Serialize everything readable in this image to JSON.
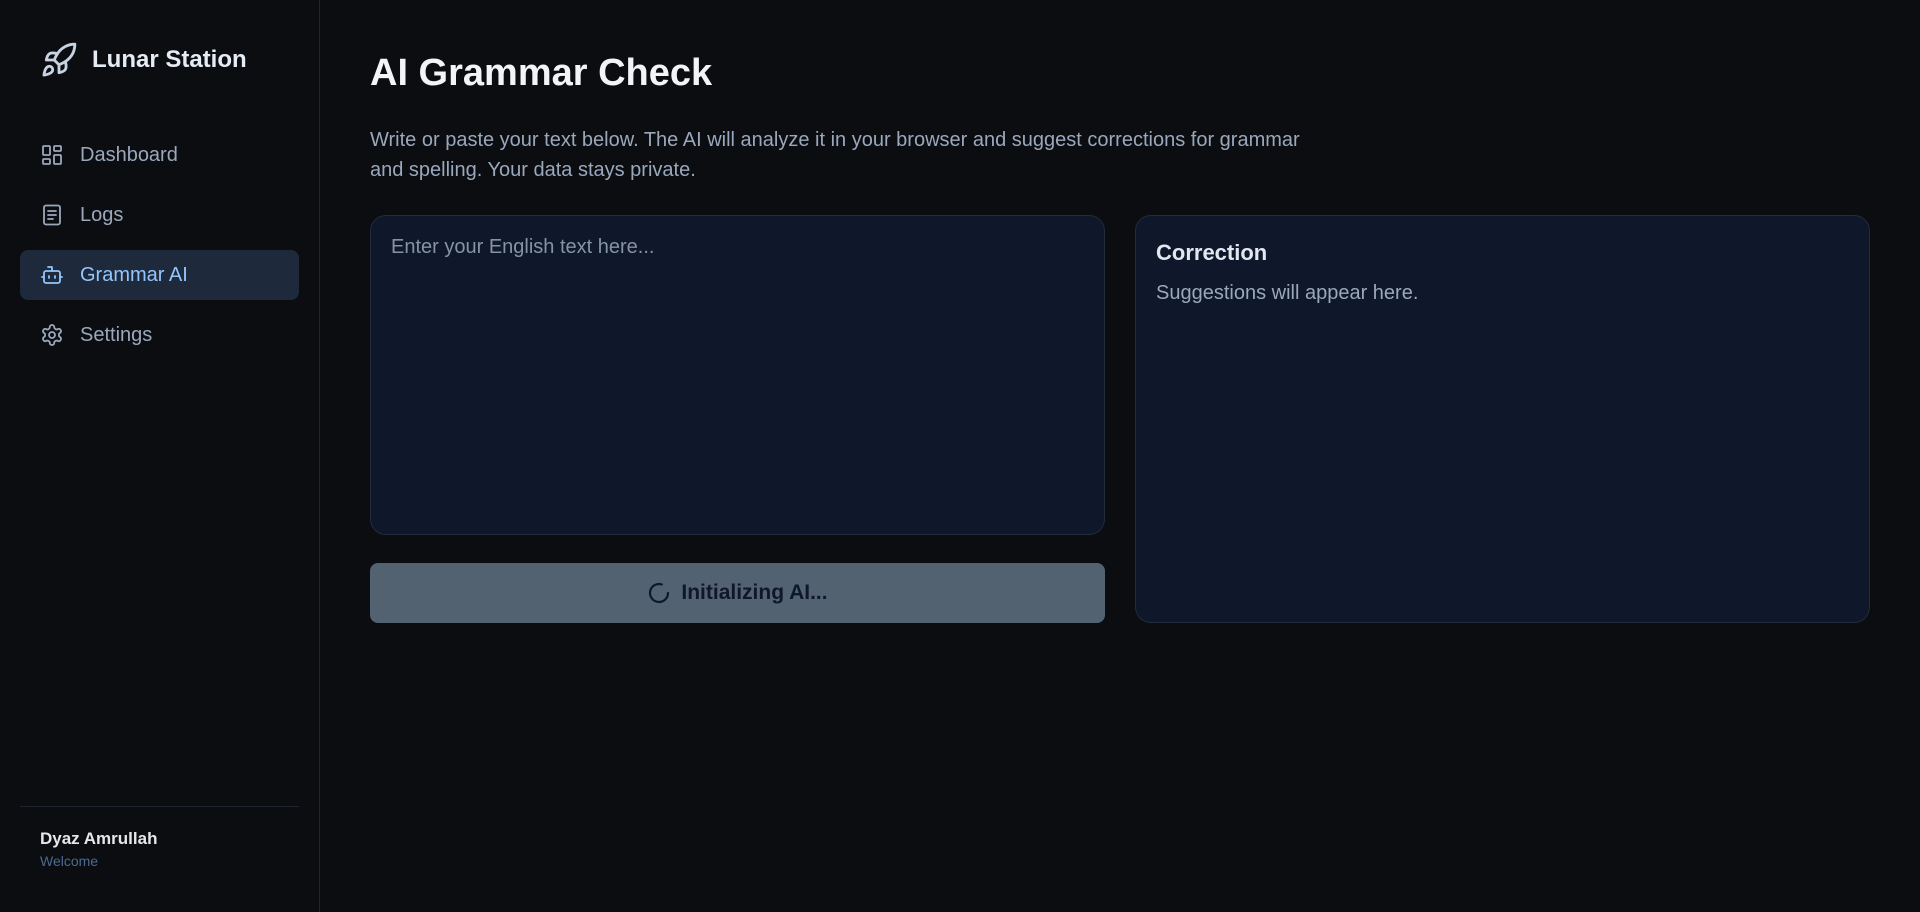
{
  "brand": {
    "name": "Lunar Station",
    "icon": "rocket-icon"
  },
  "nav": {
    "items": [
      {
        "label": "Dashboard",
        "icon": "dashboard-icon",
        "active": false
      },
      {
        "label": "Logs",
        "icon": "document-icon",
        "active": false
      },
      {
        "label": "Grammar AI",
        "icon": "robot-icon",
        "active": true
      },
      {
        "label": "Settings",
        "icon": "gear-icon",
        "active": false
      }
    ]
  },
  "user": {
    "name": "Dyaz Amrullah",
    "subtitle": "Welcome"
  },
  "main": {
    "title": "AI Grammar Check",
    "description": "Write or paste your text below. The AI will analyze it in your browser and suggest corrections for grammar and spelling. Your data stays private.",
    "input": {
      "placeholder": "Enter your English text here...",
      "value": ""
    },
    "button": {
      "label": "Initializing AI...",
      "icon": "spinner-icon"
    },
    "correction": {
      "title": "Correction",
      "text": "Suggestions will appear here."
    }
  },
  "colors": {
    "background": "#0b0d10",
    "panel": "#0f172a",
    "active_nav_bg": "#1e293b",
    "active_nav_text": "#93c5fd",
    "muted_text": "#9aa8bd",
    "button_disabled": "#536271"
  }
}
